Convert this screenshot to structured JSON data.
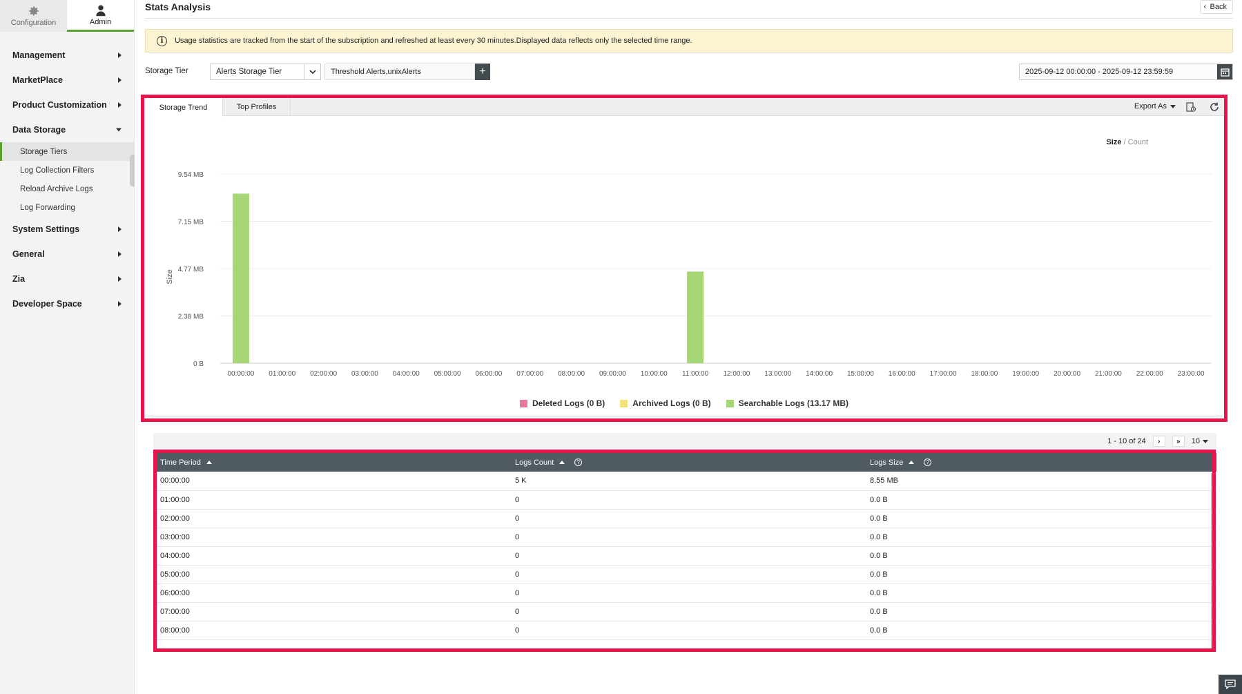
{
  "sidebar": {
    "top_tabs": [
      {
        "label": "Configuration",
        "icon": "gear-icon"
      },
      {
        "label": "Admin",
        "icon": "user-icon"
      }
    ],
    "items": [
      {
        "label": "Management"
      },
      {
        "label": "MarketPlace"
      },
      {
        "label": "Product Customization"
      },
      {
        "label": "Data Storage"
      },
      {
        "label": "System Settings"
      },
      {
        "label": "General"
      },
      {
        "label": "Zia"
      },
      {
        "label": "Developer Space"
      }
    ],
    "data_storage_sub": [
      "Storage Tiers",
      "Log Collection Filters",
      "Reload Archive Logs",
      "Log Forwarding"
    ]
  },
  "header": {
    "title": "Stats Analysis",
    "back_label": "Back"
  },
  "notice": {
    "text": "Usage statistics are tracked from the start of the subscription and refreshed at least every 30 minutes.Displayed data reflects only the selected time range."
  },
  "filters": {
    "storage_tier_label": "Storage Tier",
    "storage_tier_value": "Alerts Storage Tier",
    "profiles_value": "Threshold Alerts,unixAlerts",
    "date_range": "2025-09-12 00:00:00 - 2025-09-12 23:59:59"
  },
  "panel": {
    "tabs": [
      "Storage Trend",
      "Top Profiles"
    ],
    "export_label": "Export As",
    "toggle_size": "Size",
    "toggle_count": "Count"
  },
  "chart_data": {
    "type": "bar",
    "ylabel": "Size",
    "yticks": [
      "0 B",
      "2.38 MB",
      "4.77 MB",
      "7.15 MB",
      "9.54 MB"
    ],
    "ylim": [
      0,
      9.54
    ],
    "categories": [
      "00:00:00",
      "01:00:00",
      "02:00:00",
      "03:00:00",
      "04:00:00",
      "05:00:00",
      "06:00:00",
      "07:00:00",
      "08:00:00",
      "09:00:00",
      "10:00:00",
      "11:00:00",
      "12:00:00",
      "13:00:00",
      "14:00:00",
      "15:00:00",
      "16:00:00",
      "17:00:00",
      "18:00:00",
      "19:00:00",
      "20:00:00",
      "21:00:00",
      "22:00:00",
      "23:00:00"
    ],
    "series": [
      {
        "name": "Deleted Logs (0 B)",
        "color": "#e8799a",
        "values": [
          0,
          0,
          0,
          0,
          0,
          0,
          0,
          0,
          0,
          0,
          0,
          0,
          0,
          0,
          0,
          0,
          0,
          0,
          0,
          0,
          0,
          0,
          0,
          0
        ]
      },
      {
        "name": "Archived Logs (0 B)",
        "color": "#f2e27a",
        "values": [
          0,
          0,
          0,
          0,
          0,
          0,
          0,
          0,
          0,
          0,
          0,
          0,
          0,
          0,
          0,
          0,
          0,
          0,
          0,
          0,
          0,
          0,
          0,
          0
        ]
      },
      {
        "name": "Searchable Logs (13.17 MB)",
        "color": "#a6d676",
        "values": [
          8.55,
          0,
          0,
          0,
          0,
          0,
          0,
          0,
          0,
          0,
          0,
          4.62,
          0,
          0,
          0,
          0,
          0,
          0,
          0,
          0,
          0,
          0,
          0,
          0
        ]
      }
    ],
    "grid": true,
    "legend": "bottom"
  },
  "table": {
    "pager_text": "1 - 10 of 24",
    "per_page": "10",
    "columns": [
      "Time Period",
      "Logs Count",
      "Logs Size"
    ],
    "rows": [
      [
        "00:00:00",
        "5 K",
        "8.55 MB"
      ],
      [
        "01:00:00",
        "0",
        "0.0 B"
      ],
      [
        "02:00:00",
        "0",
        "0.0 B"
      ],
      [
        "03:00:00",
        "0",
        "0.0 B"
      ],
      [
        "04:00:00",
        "0",
        "0.0 B"
      ],
      [
        "05:00:00",
        "0",
        "0.0 B"
      ],
      [
        "06:00:00",
        "0",
        "0.0 B"
      ],
      [
        "07:00:00",
        "0",
        "0.0 B"
      ],
      [
        "08:00:00",
        "0",
        "0.0 B"
      ]
    ]
  },
  "colors": {
    "accent": "#5aa02c",
    "highlight": "#e8154b",
    "table_header": "#4f5a61"
  }
}
